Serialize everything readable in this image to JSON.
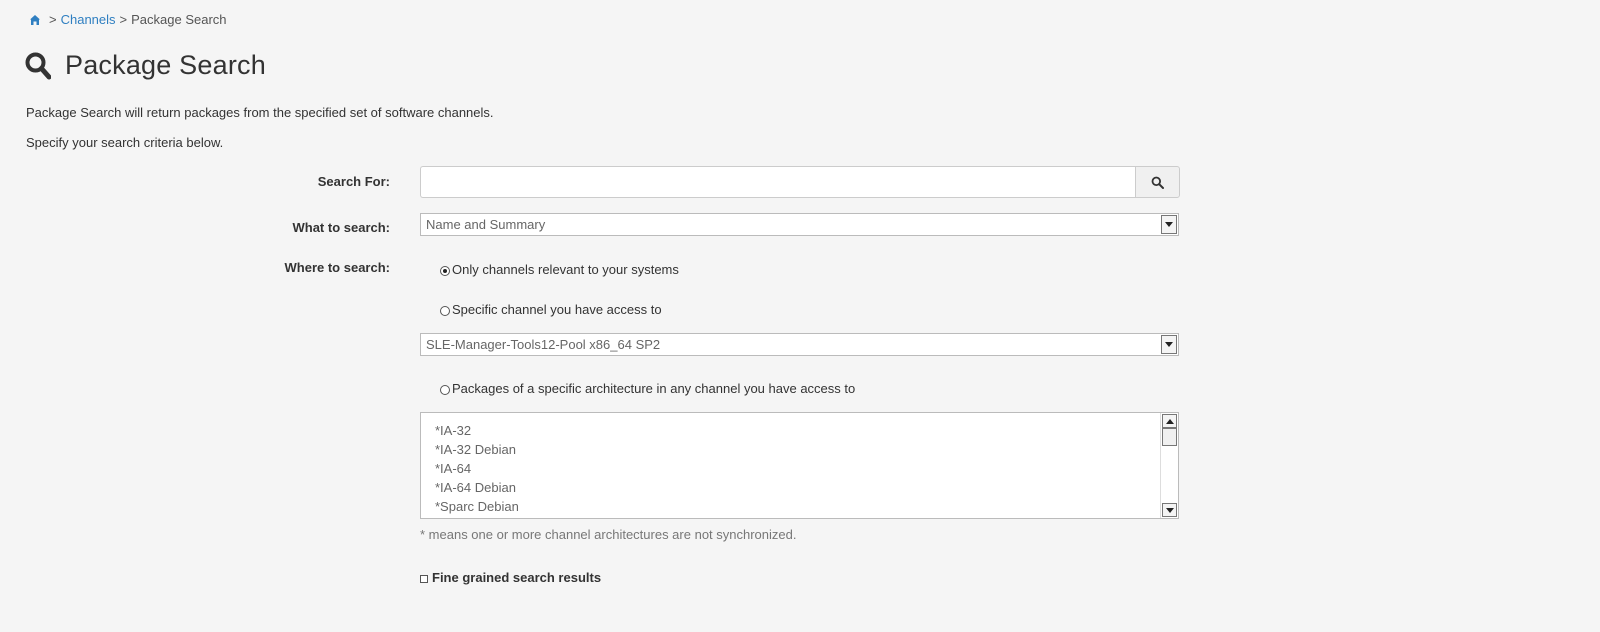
{
  "breadcrumb": {
    "home_icon": "home-icon",
    "separator": ">",
    "channels_link": "Channels",
    "current": "Package Search"
  },
  "page": {
    "title": "Package Search",
    "title_icon": "search-icon",
    "intro_1": "Package Search will return packages from the specified set of software channels.",
    "intro_2": "Specify your search criteria below."
  },
  "form": {
    "search_for_label": "Search For:",
    "search_value": "",
    "search_button_icon": "search-icon",
    "what_label": "What to search:",
    "what_selected": "Name and Summary",
    "where_label": "Where to search:",
    "where_options": [
      {
        "label": "Only channels relevant to your systems",
        "checked": true
      },
      {
        "label": "Specific channel you have access to",
        "checked": false
      },
      {
        "label": "Packages of a specific architecture in any channel you have access to",
        "checked": false
      }
    ],
    "channel_selected": "SLE-Manager-Tools12-Pool x86_64 SP2",
    "architectures": [
      "*IA-32",
      "*IA-32 Debian",
      "*IA-64",
      "*IA-64 Debian",
      "*Sparc Debian"
    ],
    "arch_note": "* means one or more channel architectures are not synchronized.",
    "fine_grained_label": "Fine grained search results",
    "fine_grained_checked": false
  },
  "colors": {
    "link": "#2f7fc1",
    "background": "#f5f5f5"
  }
}
